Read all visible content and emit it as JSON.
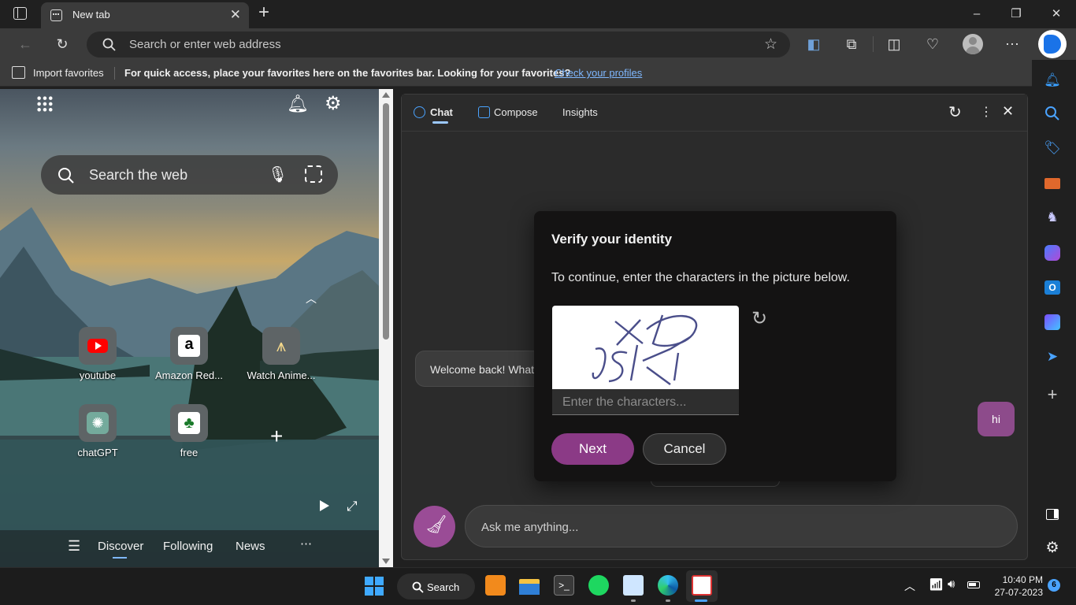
{
  "browser": {
    "tab_title": "New tab",
    "address_placeholder": "Search or enter web address"
  },
  "favorites_bar": {
    "import_label": "Import favorites",
    "message": "For quick access, place your favorites here on the favorites bar. Looking for your favorites?",
    "link": "Check your profiles"
  },
  "new_tab": {
    "search_placeholder": "Search the web",
    "tiles": [
      {
        "label": "youtube",
        "icon": "youtube-icon"
      },
      {
        "label": "Amazon Red...",
        "icon": "amazon-icon"
      },
      {
        "label": "Watch Anime...",
        "icon": "anime-icon"
      },
      {
        "label": "chatGPT",
        "icon": "chatgpt-icon"
      },
      {
        "label": "free",
        "icon": "cards-icon"
      }
    ],
    "feed_nav": [
      "Discover",
      "Following",
      "News"
    ]
  },
  "copilot": {
    "tabs": [
      "Chat",
      "Compose",
      "Insights"
    ],
    "welcome_text": "Welcome back! What",
    "user_message": "hi",
    "ask_placeholder": "Ask me anything..."
  },
  "dialog": {
    "title": "Verify your identity",
    "description": "To continue, enter the characters in the picture below.",
    "captcha_text": "XDJSK",
    "input_placeholder": "Enter the characters...",
    "next_label": "Next",
    "cancel_label": "Cancel"
  },
  "taskbar": {
    "search_label": "Search",
    "time": "10:40 PM",
    "date": "27-07-2023",
    "notification_count": "6"
  },
  "colors": {
    "accent_purple": "#8b3a86",
    "link_blue": "#7fb8ff"
  }
}
